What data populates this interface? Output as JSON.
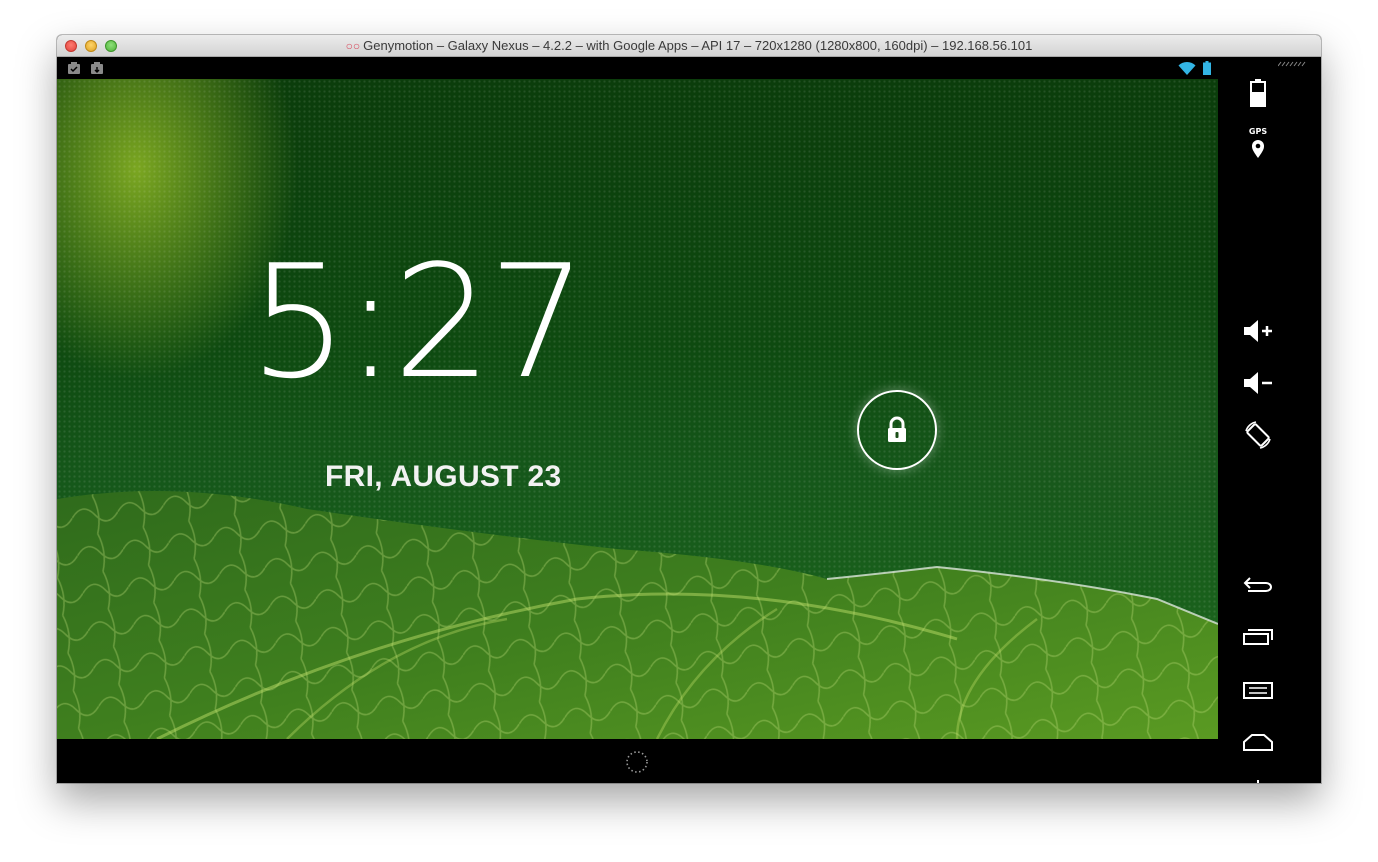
{
  "window": {
    "title": "Genymotion – Galaxy Nexus – 4.2.2 – with Google Apps – API 17 – 720x1280 (1280x800, 160dpi) – 192.168.56.101",
    "logo_glyph": "○○"
  },
  "lockscreen": {
    "time": "5:27",
    "date": "FRI, AUGUST 23"
  },
  "statusbar": {
    "left_icons": [
      "notification-icon",
      "notification-icon"
    ],
    "right_icons": [
      "wifi-icon",
      "battery-icon"
    ]
  },
  "side_panel": {
    "gps_label": "GPS",
    "buttons": [
      "battery-icon",
      "gps-icon",
      "volume-up-icon",
      "volume-down-icon",
      "rotate-icon",
      "back-icon",
      "recent-apps-icon",
      "menu-icon",
      "home-icon",
      "power-icon"
    ]
  },
  "colors": {
    "wallpaper_green": "#0e4a10",
    "accent_blue": "#33b5e5",
    "close": "#e0443e",
    "minimize": "#dea123",
    "maximize": "#4fb33a"
  }
}
